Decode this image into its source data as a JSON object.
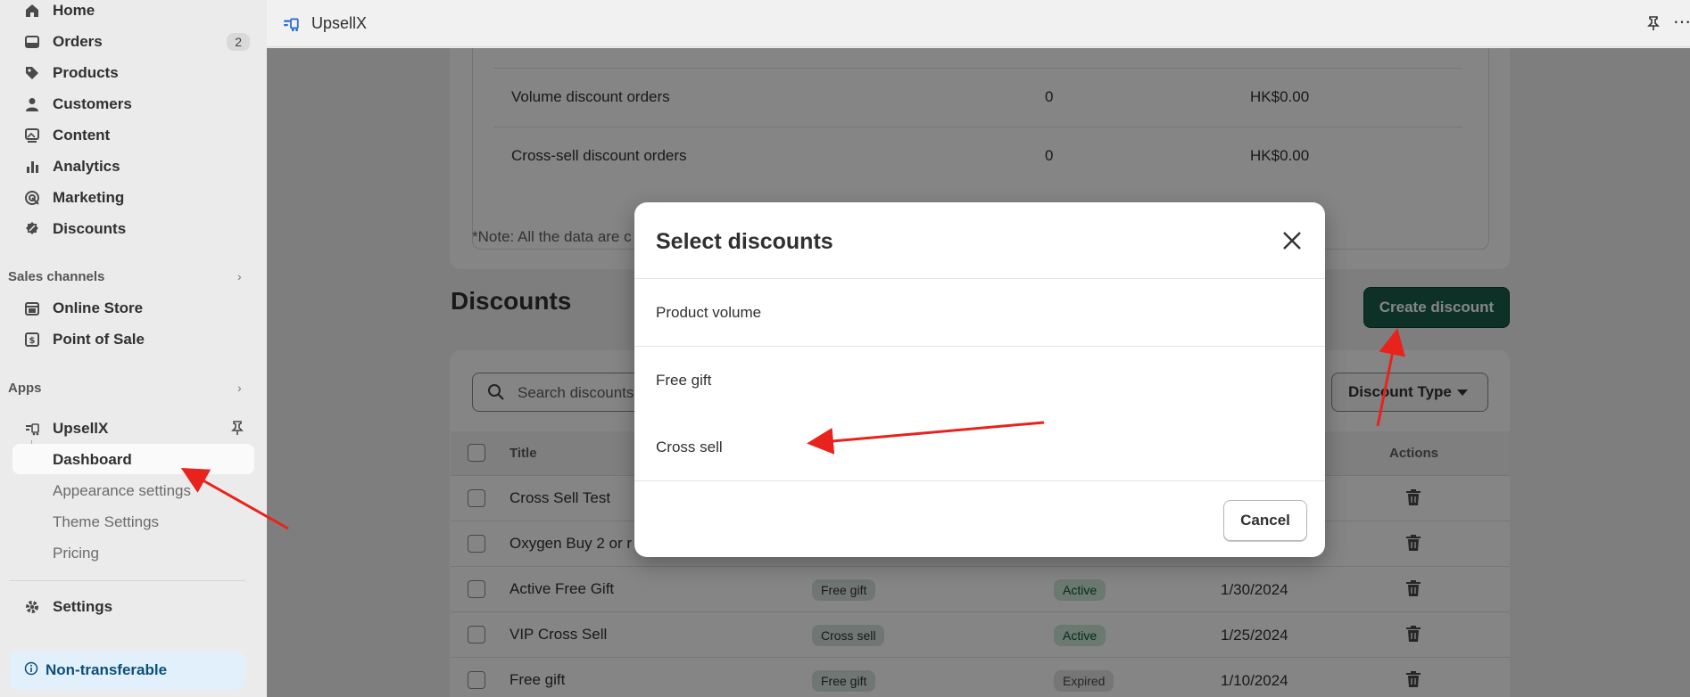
{
  "sidebar": {
    "nav": [
      {
        "label": "Home",
        "icon": "home-icon"
      },
      {
        "label": "Orders",
        "icon": "orders-icon",
        "badge": "2"
      },
      {
        "label": "Products",
        "icon": "tag-icon"
      },
      {
        "label": "Customers",
        "icon": "person-icon"
      },
      {
        "label": "Content",
        "icon": "content-icon"
      },
      {
        "label": "Analytics",
        "icon": "bar-chart-icon"
      },
      {
        "label": "Marketing",
        "icon": "target-icon"
      },
      {
        "label": "Discounts",
        "icon": "discount-icon"
      }
    ],
    "sales_channels_heading": "Sales channels",
    "channels": [
      {
        "label": "Online Store",
        "icon": "store-icon"
      },
      {
        "label": "Point of Sale",
        "icon": "pos-icon"
      }
    ],
    "apps_heading": "Apps",
    "app": {
      "label": "UpsellX",
      "icon": "upsellx-icon"
    },
    "app_sub": [
      "Dashboard",
      "Appearance settings",
      "Theme Settings",
      "Pricing"
    ],
    "settings": "Settings",
    "non_transferable": "Non-transferable"
  },
  "topbar": {
    "title": "UpsellX"
  },
  "stats": [
    {
      "label": "Volume discount orders",
      "count": "0",
      "amount": "HK$0.00"
    },
    {
      "label": "Cross-sell discount orders",
      "count": "0",
      "amount": "HK$0.00"
    }
  ],
  "note": "*Note: All the data are c",
  "discounts": {
    "title": "Discounts",
    "create_label": "Create discount",
    "search_placeholder": "Search discounts",
    "type_filter": "Discount Type",
    "columns": {
      "title": "Title",
      "actions": "Actions"
    },
    "rows": [
      {
        "title": "Cross Sell Test",
        "type": "",
        "status": "",
        "date": ""
      },
      {
        "title": "Oxygen Buy 2 or r",
        "type": "",
        "status": "",
        "date": ""
      },
      {
        "title": "Active Free Gift",
        "type": "Free gift",
        "status": "Active",
        "date": "1/30/2024"
      },
      {
        "title": "VIP Cross Sell",
        "type": "Cross sell",
        "status": "Active",
        "date": "1/25/2024"
      },
      {
        "title": "Free gift",
        "type": "Free gift",
        "status": "Expired",
        "date": "1/10/2024"
      }
    ]
  },
  "modal": {
    "title": "Select discounts",
    "options": [
      "Product volume",
      "Free gift",
      "Cross sell"
    ],
    "cancel_label": "Cancel"
  },
  "colors": {
    "primary": "#1a5e49",
    "annotation": "#e8231e"
  }
}
